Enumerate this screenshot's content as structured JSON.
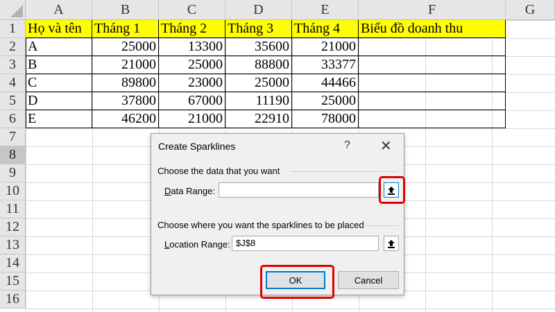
{
  "columns": [
    "A",
    "B",
    "C",
    "D",
    "E",
    "F",
    "G"
  ],
  "rows": [
    "1",
    "2",
    "3",
    "4",
    "5",
    "6",
    "7",
    "8",
    "9",
    "10",
    "11",
    "12",
    "13",
    "14",
    "15",
    "16"
  ],
  "active_row": "8",
  "table": {
    "headers": [
      "Họ và tên",
      "Tháng 1",
      "Tháng 2",
      "Tháng 3",
      "Tháng 4",
      "Biểu đồ doanh thu"
    ],
    "rows": [
      [
        "A",
        "25000",
        "13300",
        "35600",
        "21000",
        ""
      ],
      [
        "B",
        "21000",
        "25000",
        "88800",
        "33377",
        ""
      ],
      [
        "C",
        "89800",
        "23000",
        "25000",
        "44466",
        ""
      ],
      [
        "D",
        "37800",
        "67000",
        "11190",
        "25000",
        ""
      ],
      [
        "E",
        "46200",
        "21000",
        "22910",
        "78000",
        ""
      ]
    ]
  },
  "dialog": {
    "title": "Create Sparklines",
    "help": "?",
    "close": "✕",
    "section1": "Choose the data that you want",
    "data_range_label_hotkey": "D",
    "data_range_label_rest": "ata Range:",
    "data_range_value": "",
    "section2": "Choose where you want the sparklines to be placed",
    "location_label_hotkey": "L",
    "location_label_rest": "ocation Range:",
    "location_value": "$J$8",
    "ok": "OK",
    "cancel": "Cancel"
  },
  "colors": {
    "header_fill": "#ffff00",
    "highlight": "#e00000",
    "accent": "#0078d7"
  }
}
